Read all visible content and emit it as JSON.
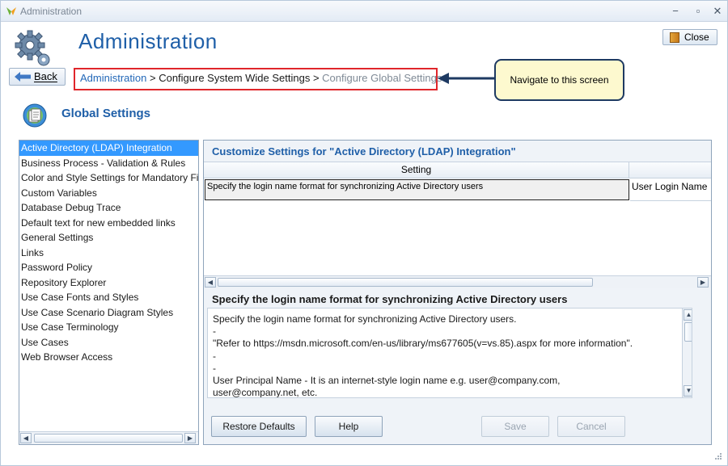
{
  "window": {
    "title": "Administration",
    "controls": {
      "minimize": "−",
      "maximize": "▫",
      "close": "✕"
    }
  },
  "header": {
    "title": "Administration",
    "close_label": "Close",
    "back_label": "Back"
  },
  "breadcrumb": {
    "link": "Administration",
    "separator1": " > ",
    "middle": "Configure System Wide Settings",
    "separator2": " > ",
    "current": "Configure Global Settings"
  },
  "callout": {
    "text": "Navigate to this screen"
  },
  "section": {
    "title": "Global Settings"
  },
  "sidebar": {
    "selected_index": 0,
    "items": [
      {
        "label": "Active Directory (LDAP) Integration"
      },
      {
        "label": "Business Process - Validation & Rules"
      },
      {
        "label": "Color and Style Settings for Mandatory Fie"
      },
      {
        "label": "Custom Variables"
      },
      {
        "label": "Database Debug Trace"
      },
      {
        "label": "Default text for new embedded links"
      },
      {
        "label": "General Settings"
      },
      {
        "label": "Links"
      },
      {
        "label": "Password Policy"
      },
      {
        "label": "Repository Explorer"
      },
      {
        "label": "Use Case Fonts and Styles"
      },
      {
        "label": "Use Case Scenario Diagram Styles"
      },
      {
        "label": "Use Case Terminology"
      },
      {
        "label": "Use Cases"
      },
      {
        "label": "Web Browser Access"
      }
    ]
  },
  "main": {
    "customize_title": "Customize Settings for \"Active Directory (LDAP) Integration\"",
    "grid": {
      "columns": [
        "Setting",
        ""
      ],
      "rows": [
        {
          "setting": "Specify the login name format for synchronizing Active Directory users",
          "value": "User Login Name"
        }
      ]
    },
    "description": {
      "title": "Specify the login name format for synchronizing Active Directory users",
      "lines": [
        "Specify the login name format for synchronizing Active Directory users.",
        "-",
        "\"Refer to https://msdn.microsoft.com/en-us/library/ms677605(v=vs.85).aspx for more information\".",
        "-",
        "-",
        "User Principal Name - It is an internet-style login name e.g. user@company.com,",
        "user@company.net, etc."
      ]
    },
    "buttons": {
      "restore_defaults": "Restore Defaults",
      "help": "Help",
      "save": "Save",
      "cancel": "Cancel"
    }
  },
  "colors": {
    "accent": "#1f5fa8",
    "selection": "#3399ff",
    "highlight_border": "#e0262b",
    "callout_bg": "#fdf9cf"
  }
}
